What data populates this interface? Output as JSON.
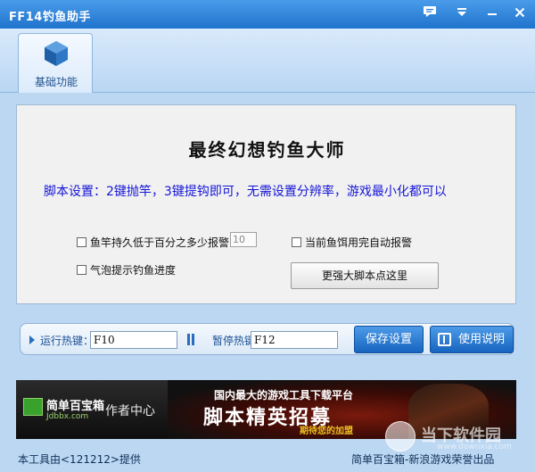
{
  "window": {
    "title": "FF14钓鱼助手"
  },
  "tabs": [
    {
      "label": "基础功能",
      "icon": "cube-icon"
    }
  ],
  "main": {
    "headline": "最终幻想钓鱼大师",
    "description": "脚本设置：2键抛竿，3键提钩即可，无需设置分辨率，游戏最小化都可以",
    "options": {
      "durability_alarm": {
        "label": "鱼竿持久低于百分之多少报警",
        "checked": false,
        "value": "10"
      },
      "bait_alarm": {
        "label": "当前鱼饵用完自动报警",
        "checked": false
      },
      "bubble_progress": {
        "label": "气泡提示钓鱼进度",
        "checked": false
      }
    },
    "more_script_button": "更强大脚本点这里"
  },
  "hotkeys": {
    "run_label": "运行热键：",
    "run_value": "F10",
    "pause_label": "暂停热键：",
    "pause_value": "F12",
    "save_button": "保存设置",
    "help_button": "使用说明"
  },
  "banner": {
    "logo_name": "简单百宝箱",
    "logo_sub": "Jdbbx.com",
    "author_center": "作者中心",
    "line1": "国内最大的游戏工具下载平台",
    "line2": "脚本精英招募",
    "line3": "期待您的加盟"
  },
  "footer": {
    "left": "本工具由<121212>提供",
    "right": "简单百宝箱-新浪游戏荣誉出品"
  },
  "watermark": {
    "text": "当下软件园",
    "url": "www.downxia.com"
  },
  "colors": {
    "title_bar": "#1f73cc",
    "accent_blue": "#1564bf",
    "description_text": "#1515d8"
  }
}
